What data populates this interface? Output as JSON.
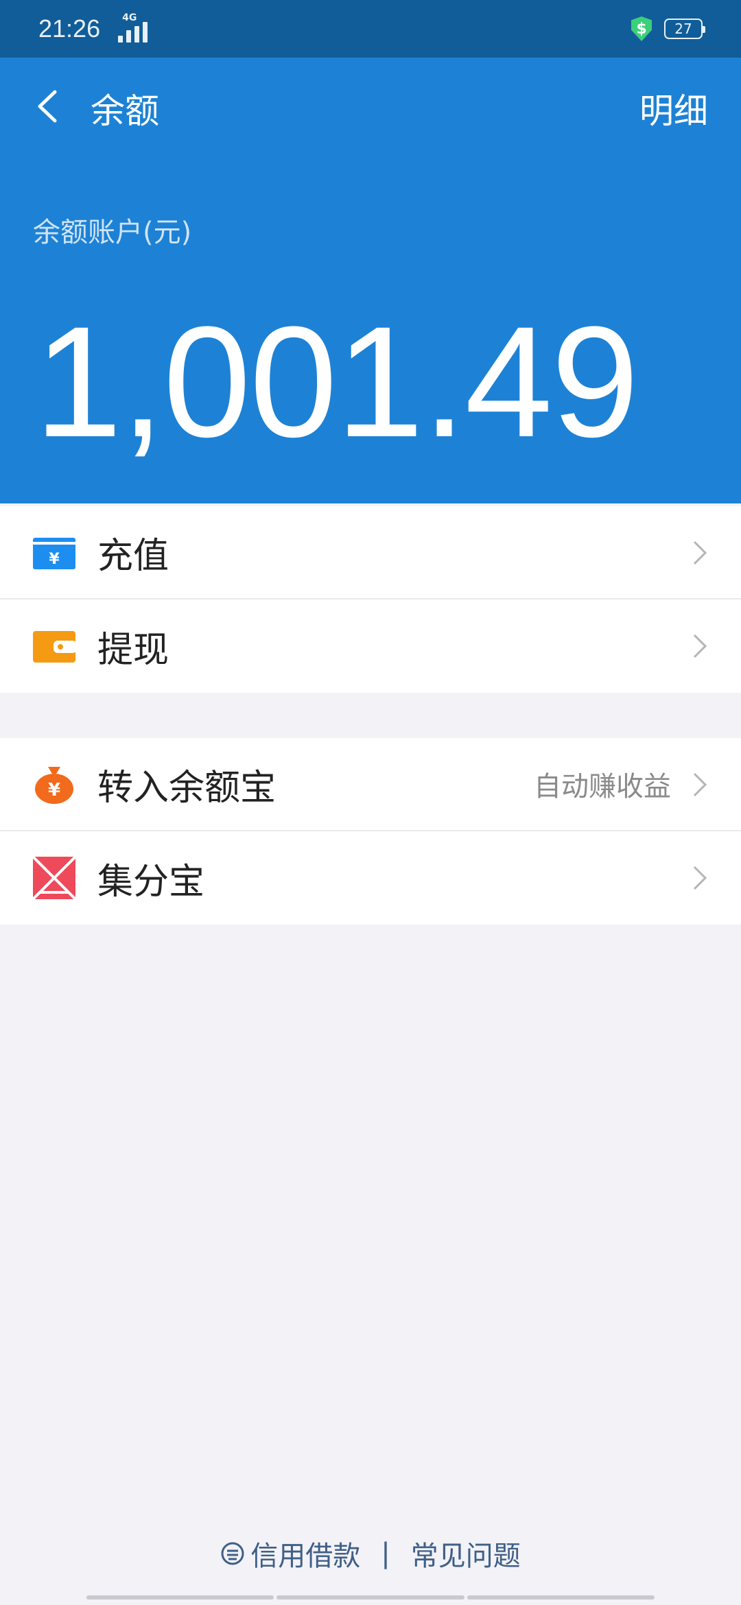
{
  "status_bar": {
    "time": "21:26",
    "network": "4G",
    "battery": "27"
  },
  "nav": {
    "title": "余额",
    "detail_label": "明细"
  },
  "balance": {
    "label": "余额账户(元)",
    "value": "1,001.49"
  },
  "groups": [
    {
      "items": [
        {
          "label": "充值",
          "icon": "recharge-card-icon",
          "icon_color": "#1d8ef0"
        },
        {
          "label": "提现",
          "icon": "wallet-icon",
          "icon_color": "#f59a13"
        }
      ]
    },
    {
      "items": [
        {
          "label": "转入余额宝",
          "extra": "自动赚收益",
          "icon": "money-bag-icon",
          "icon_color": "#f26a1b"
        },
        {
          "label": "集分宝",
          "icon": "jifenbao-icon",
          "icon_color": "#ee4a5b"
        }
      ]
    }
  ],
  "footer": {
    "credit_loan": "信用借款",
    "separator": "|",
    "faq": "常见问题"
  },
  "colors": {
    "header_blue": "#1d82d5",
    "status_bar": "#115d99",
    "background": "#f2f2f7"
  }
}
